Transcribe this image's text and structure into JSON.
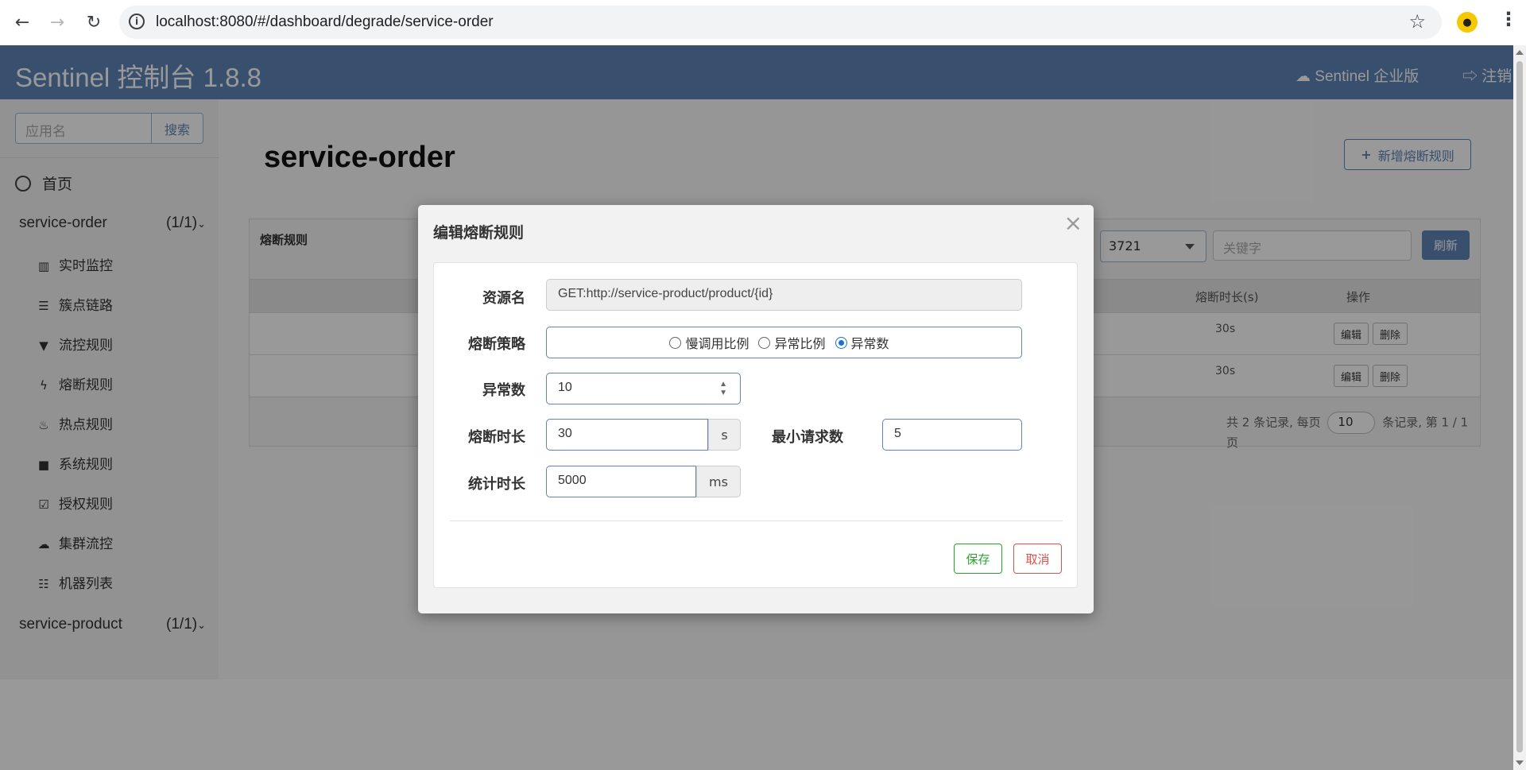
{
  "browser": {
    "url": "localhost:8080/#/dashboard/degrade/service-order"
  },
  "header": {
    "title": "Sentinel 控制台 1.8.8",
    "enterprise_link": "Sentinel 企业版",
    "logout_link": "注销"
  },
  "sidebar": {
    "search_placeholder": "应用名",
    "search_button": "搜索",
    "home": "首页",
    "apps": [
      {
        "name": "service-order",
        "count": "(1/1)"
      },
      {
        "name": "service-product",
        "count": "(1/1)"
      }
    ],
    "items": [
      {
        "label": "实时监控",
        "icon": "bar-chart-icon"
      },
      {
        "label": "簇点链路",
        "icon": "list-icon"
      },
      {
        "label": "流控规则",
        "icon": "filter-icon"
      },
      {
        "label": "熔断规则",
        "icon": "bolt-icon"
      },
      {
        "label": "热点规则",
        "icon": "fire-icon"
      },
      {
        "label": "系统规则",
        "icon": "lock-icon"
      },
      {
        "label": "授权规则",
        "icon": "check-square-icon"
      },
      {
        "label": "集群流控",
        "icon": "cloud-icon"
      },
      {
        "label": "机器列表",
        "icon": "th-list-icon"
      }
    ]
  },
  "main": {
    "page_title": "service-order",
    "add_button": "新增熔断规则",
    "panel_label": "熔断规则",
    "ip_select_value": "3721",
    "keyword_placeholder": "关键字",
    "refresh_button": "刷新",
    "columns": {
      "duration": "熔断时长(s)",
      "actions": "操作"
    },
    "rows": [
      {
        "duration": "30s",
        "edit": "编辑",
        "delete": "删除"
      },
      {
        "duration": "30s",
        "edit": "编辑",
        "delete": "删除"
      }
    ],
    "pager": {
      "prefix": "共 2 条记录, 每页",
      "page_size": "10",
      "suffix": "条记录, 第 1 / 1 页"
    }
  },
  "modal": {
    "title": "编辑熔断规则",
    "resource_label": "资源名",
    "resource_value": "GET:http://service-product/product/{id}",
    "strategy_label": "熔断策略",
    "strategies": [
      "慢调用比例",
      "异常比例",
      "异常数"
    ],
    "strategy_selected": "异常数",
    "exception_count_label": "异常数",
    "exception_count_value": "10",
    "duration_label": "熔断时长",
    "duration_value": "30",
    "duration_unit": "s",
    "min_request_label": "最小请求数",
    "min_request_value": "5",
    "stat_label": "统计时长",
    "stat_value": "5000",
    "stat_unit": "ms",
    "save_button": "保存",
    "cancel_button": "取消"
  }
}
